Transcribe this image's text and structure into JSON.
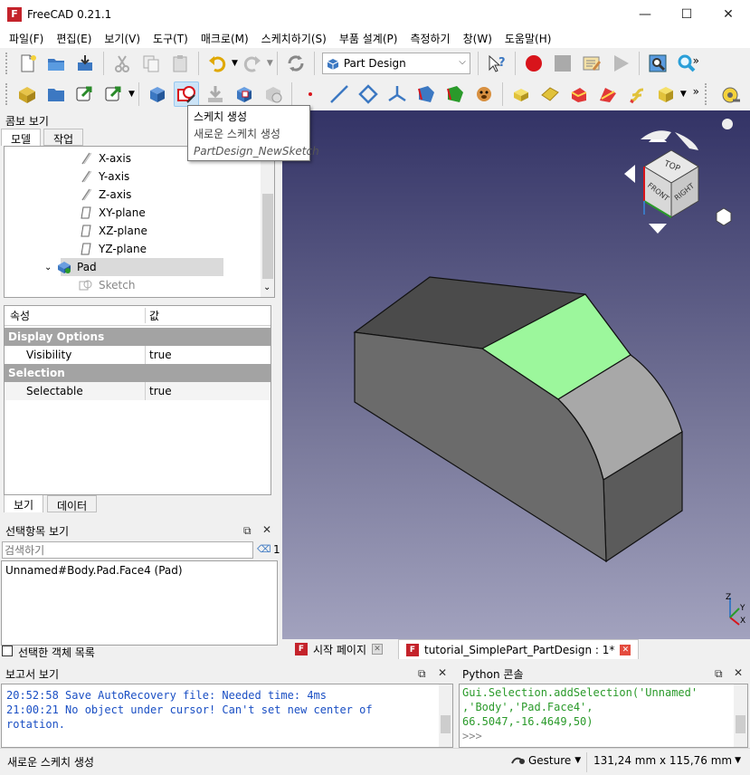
{
  "window": {
    "title": "FreeCAD 0.21.1",
    "app_icon_letter": "F",
    "minimize": "—",
    "maximize": "☐",
    "close": "✕"
  },
  "menu": [
    "파일(F)",
    "편집(E)",
    "보기(V)",
    "도구(T)",
    "매크로(M)",
    "스케치하기(S)",
    "부품 설계(P)",
    "측정하기",
    "창(W)",
    "도움말(H)"
  ],
  "toolbar": {
    "workbench": "Part Design",
    "overflow": "»"
  },
  "tooltip": {
    "title": "스케치 생성",
    "description": "새로운 스케치 생성",
    "command": "PartDesign_NewSketch"
  },
  "combo_view": {
    "title": "콤보 보기",
    "tabs": [
      "모델",
      "작업"
    ],
    "tree": [
      {
        "label": "X-axis",
        "indent": 2,
        "icon": "axis-icon"
      },
      {
        "label": "Y-axis",
        "indent": 2,
        "icon": "axis-icon"
      },
      {
        "label": "Z-axis",
        "indent": 2,
        "icon": "axis-icon"
      },
      {
        "label": "XY-plane",
        "indent": 2,
        "icon": "plane-icon"
      },
      {
        "label": "XZ-plane",
        "indent": 2,
        "icon": "plane-icon"
      },
      {
        "label": "YZ-plane",
        "indent": 2,
        "icon": "plane-icon"
      },
      {
        "label": "Pad",
        "indent": 1,
        "icon": "pad-icon"
      },
      {
        "label": "Sketch",
        "indent": 2,
        "icon": "sketch-icon"
      }
    ],
    "prop_headers": [
      "속성",
      "값"
    ],
    "groups": [
      {
        "name": "Display Options",
        "props": [
          {
            "name": "Visibility",
            "value": "true"
          }
        ]
      },
      {
        "name": "Selection",
        "props": [
          {
            "name": "Selectable",
            "value": "true"
          }
        ]
      }
    ],
    "bottom_tabs": [
      "보기",
      "데이터"
    ]
  },
  "selection_view": {
    "title": "선택항목 보기",
    "search_placeholder": "검색하기",
    "count": "1",
    "items": [
      "Unnamed#Body.Pad.Face4 (Pad)"
    ],
    "picked_list_label": "선택한 객체 목록"
  },
  "nav_cube": {
    "top": "TOP",
    "front": "FRONT",
    "right": "RIGHT"
  },
  "axis_labels": {
    "x": "X",
    "y": "Y",
    "z": "Z"
  },
  "doc_tabs": [
    {
      "label": "시작 페이지"
    },
    {
      "label": "tutorial_SimplePart_PartDesign : 1*"
    }
  ],
  "report_view": {
    "title": "보고서 보기",
    "lines": [
      "20:52:58  Save AutoRecovery file: Needed time: 4ms",
      "21:00:21  No object under cursor! Can't set new center of",
      "rotation."
    ]
  },
  "python_console": {
    "title": "Python 콘솔",
    "lines": [
      "Gui.Selection.addSelection('Unnamed'",
      ",'Body','Pad.Face4',",
      "66.5047,-16.4649,50)"
    ],
    "prompt": ">>>"
  },
  "status": {
    "message": "새로운 스케치 생성",
    "nav_style": "Gesture",
    "dimensions": "131,24 mm x 115,76 mm"
  },
  "colors": {
    "selected_face": "#9cf79c",
    "freecad_red": "#c4232b"
  }
}
